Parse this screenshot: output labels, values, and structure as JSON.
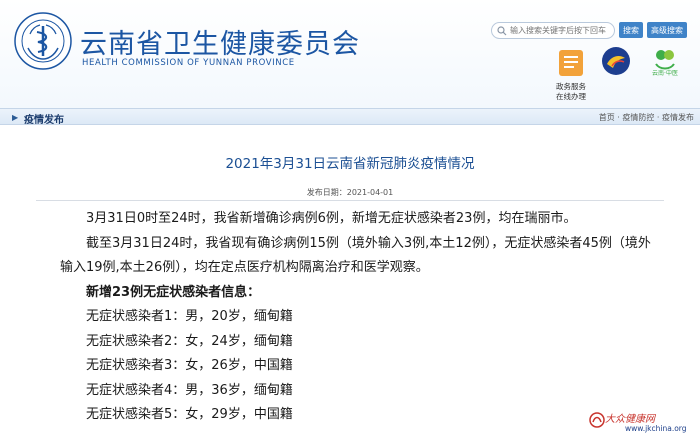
{
  "header": {
    "title": "云南省卫生健康委员会",
    "subtitle": "HEALTH COMMISSION OF YUNNAN PROVINCE",
    "emblem_text": "云南省卫生健康委员会",
    "search": {
      "placeholder": "输入搜索关键字后按下回车",
      "search_label": "搜索",
      "advanced_label": "高级搜索"
    },
    "services": [
      {
        "icon": "document-service-icon",
        "label_line1": "政务服务",
        "label_line2": "在线办理"
      },
      {
        "icon": "bird-emblem-icon"
      },
      {
        "icon": "healthy-yunnan-icon"
      }
    ]
  },
  "nav": {
    "title": "疫情发布",
    "breadcrumb": [
      "首页",
      "疫情防控",
      "疫情发布"
    ],
    "separator": "·"
  },
  "article": {
    "title": "2021年3月31日云南省新冠肺炎疫情情况",
    "date_label": "发布日期：2021-04-01",
    "paragraphs": [
      "3月31日0时至24时，我省新增确诊病例6例，新增无症状感染者23例，均在瑞丽市。",
      "截至3月31日24时，我省现有确诊病例15例（境外输入3例,本土12例），无症状感染者45例（境外输入19例,本土26例），均在定点医疗机构隔离治疗和医学观察。"
    ],
    "section_heading": "新增23例无症状感染者信息：",
    "cases": [
      "无症状感染者1：男，20岁，缅甸籍",
      "无症状感染者2：女，24岁，缅甸籍",
      "无症状感染者3：女，26岁，中国籍",
      "无症状感染者4：男，36岁，缅甸籍",
      "无症状感染者5：女，29岁，中国籍"
    ]
  },
  "watermark": {
    "name": "大众健康网",
    "url": "www.jkchina.org"
  },
  "colors": {
    "brand_blue": "#1c56a3",
    "nav_bg": "#dde9f6",
    "watermark_red": "#c8342d"
  }
}
